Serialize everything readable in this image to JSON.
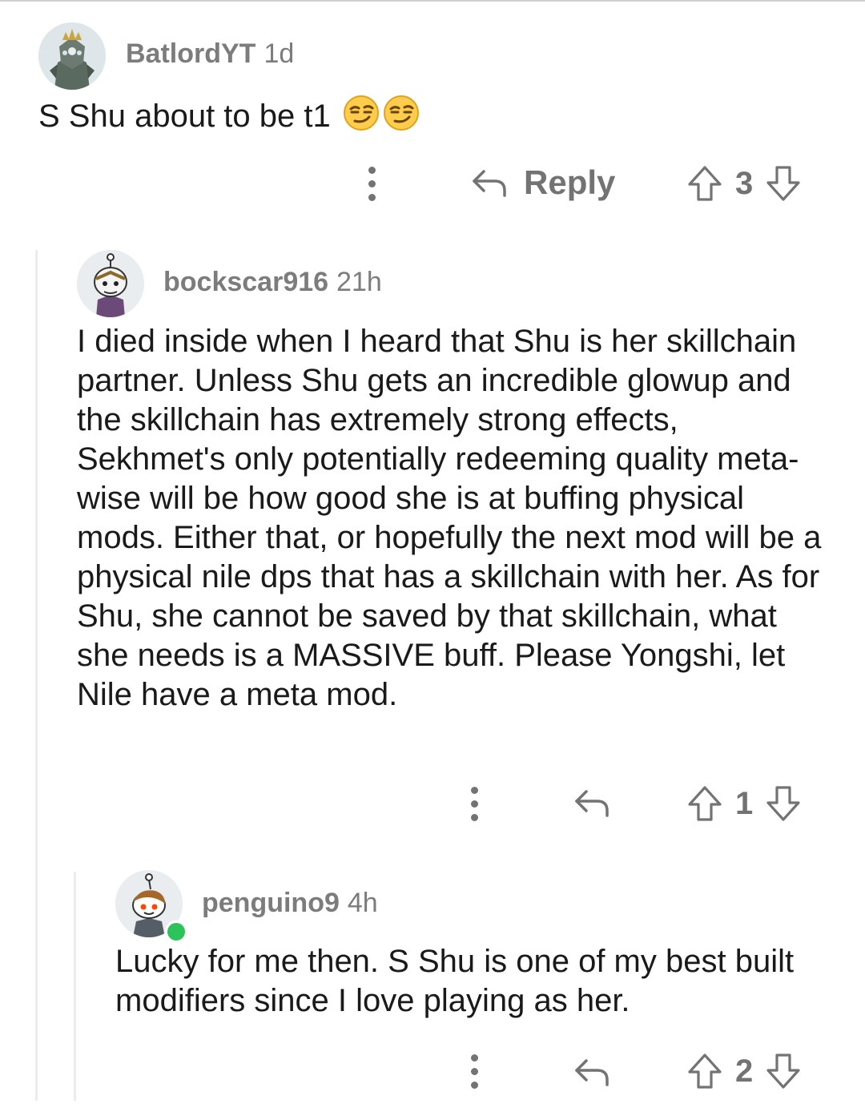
{
  "comments": [
    {
      "user": "BatlordYT",
      "age": "1d",
      "text": "S Shu about to be t1",
      "emoji": "smirking-face-emoji",
      "reply_label": "Reply",
      "score": "3"
    },
    {
      "user": "bockscar916",
      "age": "21h",
      "text": "I died inside when I heard that Shu is her skillchain partner. Unless Shu gets an incredible glowup and the skillchain has extremely strong effects, Sekhmet's only potentially redeeming quality meta-wise will be how good she is at buffing physical mods. Either that, or hopefully the next mod will be a physical nile dps that has a skillchain with her. As for Shu, she cannot be saved by that skillchain, what she needs is a MASSIVE buff. Please Yongshi, let Nile have a meta mod.",
      "score": "1"
    },
    {
      "user": "penguino9",
      "age": "4h",
      "text": "Lucky for me then. S Shu is one of my best built modifiers since I love playing as her.",
      "score": "2",
      "online": true
    }
  ],
  "icons": {
    "more": "more-vertical-icon",
    "reply": "reply-arrow-icon",
    "upvote": "upvote-arrow-icon",
    "downvote": "downvote-arrow-icon"
  },
  "colors": {
    "meta": "#7c7c7c",
    "online": "#2bc35a",
    "snoo_eye": "#ff4500"
  }
}
